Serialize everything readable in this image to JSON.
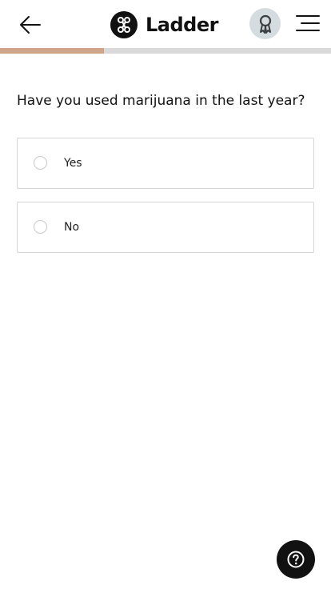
{
  "header": {
    "back_icon": "arrow-left-icon",
    "logo_icon": "ladder-logo-icon",
    "logo_text": "Ladder",
    "award_icon": "award-ribbon-icon",
    "menu_icon": "hamburger-menu-icon"
  },
  "progress": {
    "fraction": 0.315,
    "fill_color": "#cfa488",
    "track_color": "#d9d9d9"
  },
  "question": {
    "text": "Have you used marijuana in the last year?",
    "options": [
      {
        "label": "Yes",
        "selected": false
      },
      {
        "label": "No",
        "selected": false
      }
    ]
  },
  "help": {
    "icon": "help-question-icon"
  }
}
